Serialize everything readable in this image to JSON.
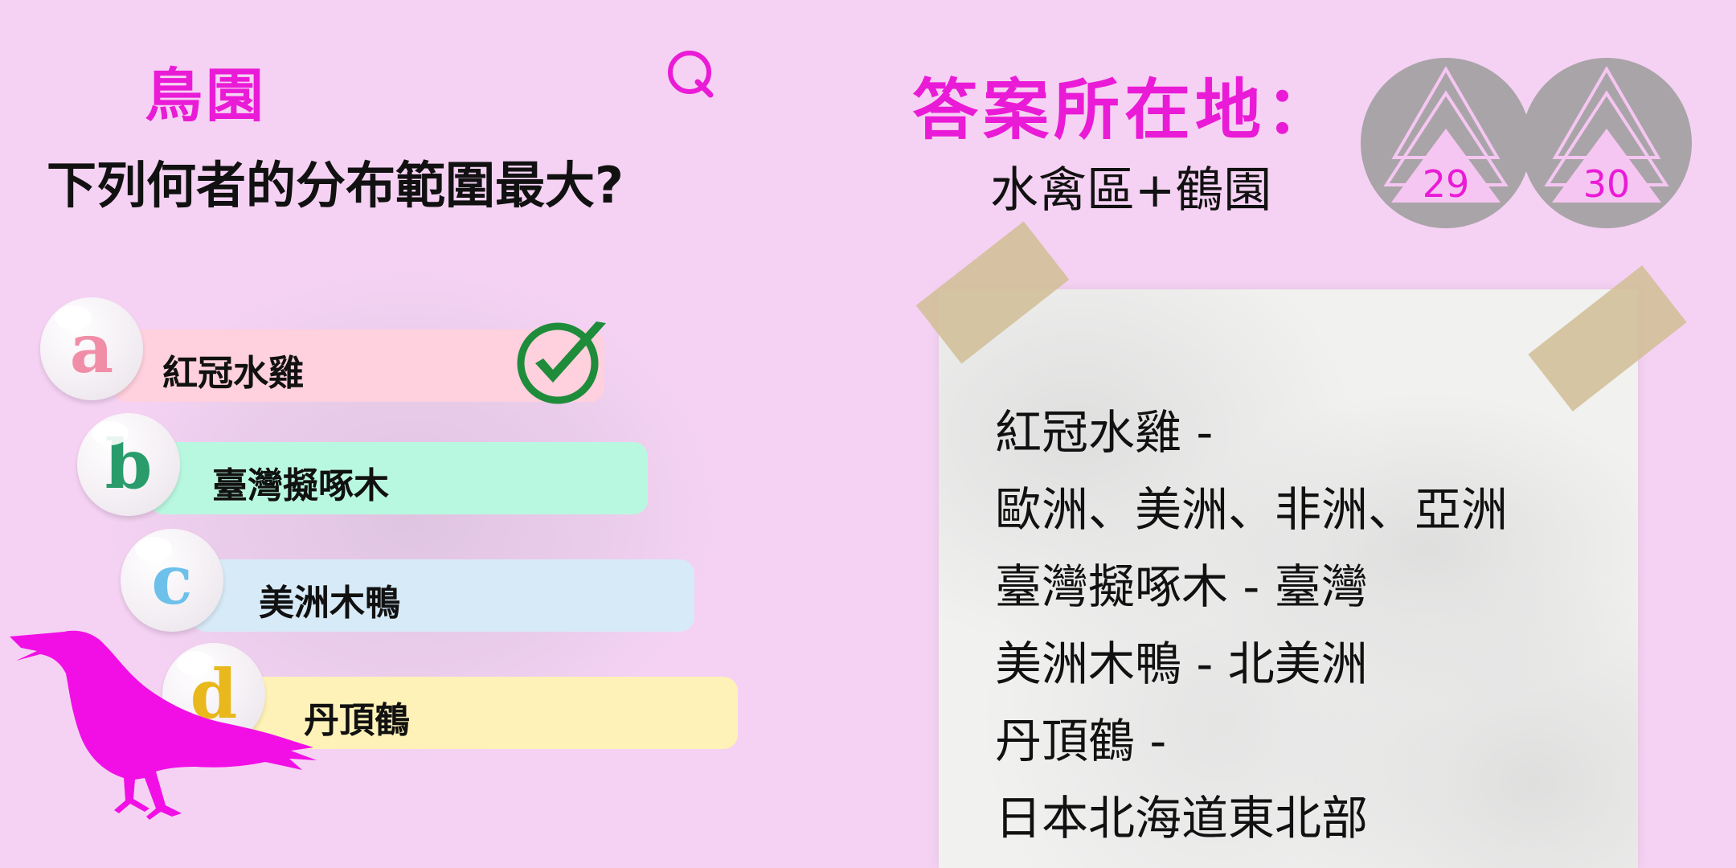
{
  "quiz": {
    "section_title": "鳥園",
    "question_text": "下列何者的分布範圍最大?",
    "options": [
      {
        "letter": "a",
        "label": "紅冠水雞"
      },
      {
        "letter": "b",
        "label": "臺灣擬啄木"
      },
      {
        "letter": "c",
        "label": "美洲木鴨"
      },
      {
        "letter": "d",
        "label": "丹頂鶴"
      }
    ],
    "correct_option": "a"
  },
  "answer": {
    "location_title": "答案所在地：",
    "location_value": "水禽區+鶴園",
    "explanation_lines": [
      "紅冠水雞 -",
      "歐洲、美洲、非洲、亞洲",
      "臺灣擬啄木 - 臺灣",
      "美洲木鴨 - 北美洲",
      "丹頂鶴 -",
      "日本北海道東北部"
    ]
  },
  "badges": [
    {
      "number": "29"
    },
    {
      "number": "30"
    }
  ],
  "icons": {
    "question_badge": "q-icon",
    "correct_mark": "check-icon",
    "bird": "bird-silhouette-icon"
  },
  "colors": {
    "background": "#f5d2f3",
    "accent": "#ea1bd6",
    "option_a": "#ffd0dd",
    "option_b": "#b9f8e0",
    "option_c": "#d7eaf7",
    "option_d": "#fff2b8",
    "letter_a": "#f08ea8",
    "letter_b": "#2a9c6c",
    "letter_c": "#6cc0ea",
    "letter_d": "#e8b81c",
    "check": "#1e8c3a"
  }
}
